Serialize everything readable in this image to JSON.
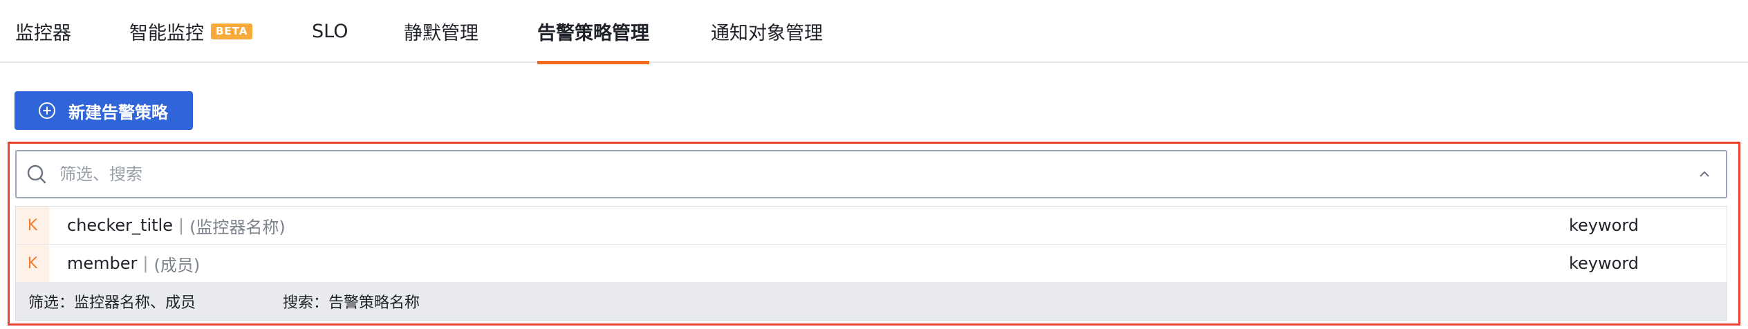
{
  "tabs": [
    {
      "label": "监控器"
    },
    {
      "label": "智能监控",
      "badge": "BETA"
    },
    {
      "label": "SLO"
    },
    {
      "label": "静默管理"
    },
    {
      "label": "告警策略管理",
      "active": true
    },
    {
      "label": "通知对象管理"
    }
  ],
  "create_button": {
    "label": "新建告警策略",
    "icon": "plus-circle-icon"
  },
  "search": {
    "placeholder": "筛选、搜索",
    "icon": "search-icon",
    "toggle_icon": "chevron-up-icon"
  },
  "suggestions": [
    {
      "kind": "K",
      "field": "checker_title",
      "separator": "|",
      "desc": "(监控器名称)",
      "type": "keyword"
    },
    {
      "kind": "K",
      "field": "member",
      "separator": "|",
      "desc": "(成员)",
      "type": "keyword"
    }
  ],
  "hints": {
    "filter": "筛选：监控器名称、成员",
    "search": "搜索：告警策略名称"
  },
  "colors": {
    "accent": "#f36b1f",
    "primary_button": "#2f65d8",
    "highlight_border": "#e8442f",
    "badge": "#f7a93b"
  }
}
